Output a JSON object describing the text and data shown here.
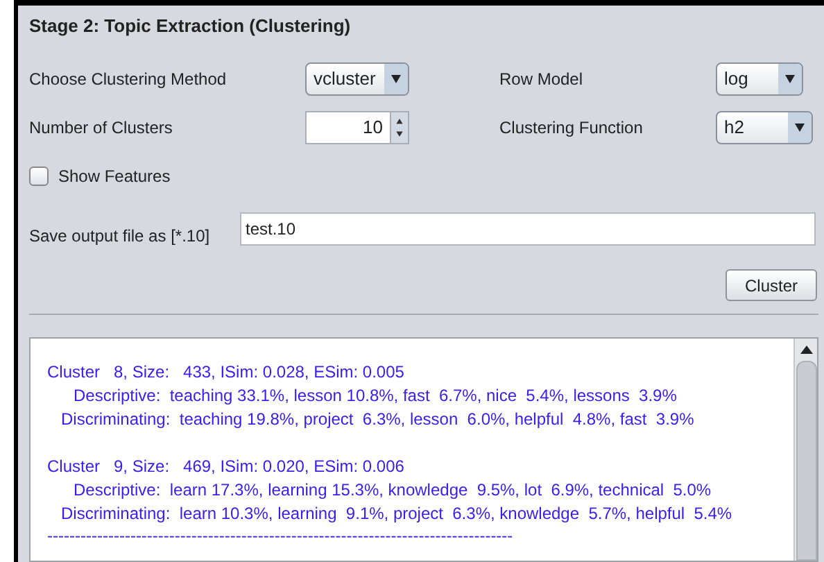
{
  "panel": {
    "title": "Stage 2: Topic Extraction (Clustering)"
  },
  "method": {
    "label": "Choose Clustering Method",
    "value": "vcluster"
  },
  "row_model": {
    "label": "Row Model",
    "value": "log"
  },
  "clusters": {
    "label": "Number of Clusters",
    "value": "10"
  },
  "function": {
    "label": "Clustering Function",
    "value": "h2"
  },
  "show_features": {
    "label": "Show Features",
    "checked": false
  },
  "save": {
    "label": "Save output file as [*.10]",
    "value": "test.10"
  },
  "cluster_button": "Cluster",
  "output": {
    "clusters": [
      {
        "header": "Cluster   8, Size:   433, ISim: 0.028, ESim: 0.005",
        "descriptive": "Descriptive:  teaching 33.1%, lesson 10.8%, fast  6.7%, nice  5.4%, lessons  3.9%",
        "discriminating": "Discriminating:  teaching 19.8%, project  6.3%, lesson  6.0%, helpful  4.8%, fast  3.9%"
      },
      {
        "header": "Cluster   9, Size:   469, ISim: 0.020, ESim: 0.006",
        "descriptive": "Descriptive:  learn 17.3%, learning 15.3%, knowledge  9.5%, lot  6.9%, technical  5.0%",
        "discriminating": "Discriminating:  learn 10.3%, learning  9.1%, project  6.3%, knowledge  5.7%, helpful  5.4%"
      }
    ],
    "separator": "------------------------------------------------------------------------------------"
  }
}
